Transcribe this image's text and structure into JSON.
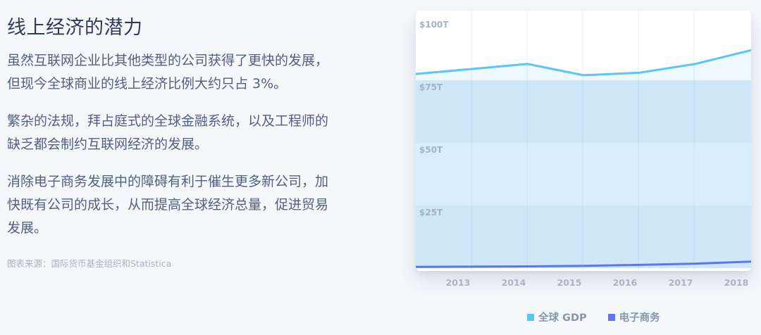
{
  "heading": "线上经济的潜力",
  "paragraphs": [
    "虽然互联网企业比其他类型的公司获得了更快的发展，但现今全球商业的线上经济比例大约只占 3%。",
    "繁杂的法规，拜占庭式的全球金融系统，以及工程师的缺乏都会制约互联网经济的发展。",
    "消除电子商务发展中的障碍有利于催生更多新公司，加快既有公司的成长，从而提高全球经济总量，促进贸易发展。"
  ],
  "source": "图表来源：国际货币基金组织和Statistica",
  "colors": {
    "gdp": "#5bc5f8",
    "ecommerce": "#6172f3"
  },
  "chart_data": {
    "type": "area",
    "x": [
      "2013",
      "2014",
      "2015",
      "2016",
      "2017",
      "2018"
    ],
    "y_ticks": [
      "$25T",
      "$50T",
      "$75T",
      "$100T"
    ],
    "y_tick_values": [
      25,
      50,
      75,
      100
    ],
    "ylim": [
      0,
      100
    ],
    "grid": true,
    "legend_position": "bottom",
    "series": [
      {
        "name": "全球 GDP",
        "values": [
          77.5,
          79.5,
          81.5,
          77.0,
          78.0,
          81.5,
          87.0
        ]
      },
      {
        "name": "电子商务",
        "values": [
          0.5,
          0.6,
          0.7,
          0.9,
          1.3,
          1.8,
          2.6
        ]
      }
    ]
  }
}
